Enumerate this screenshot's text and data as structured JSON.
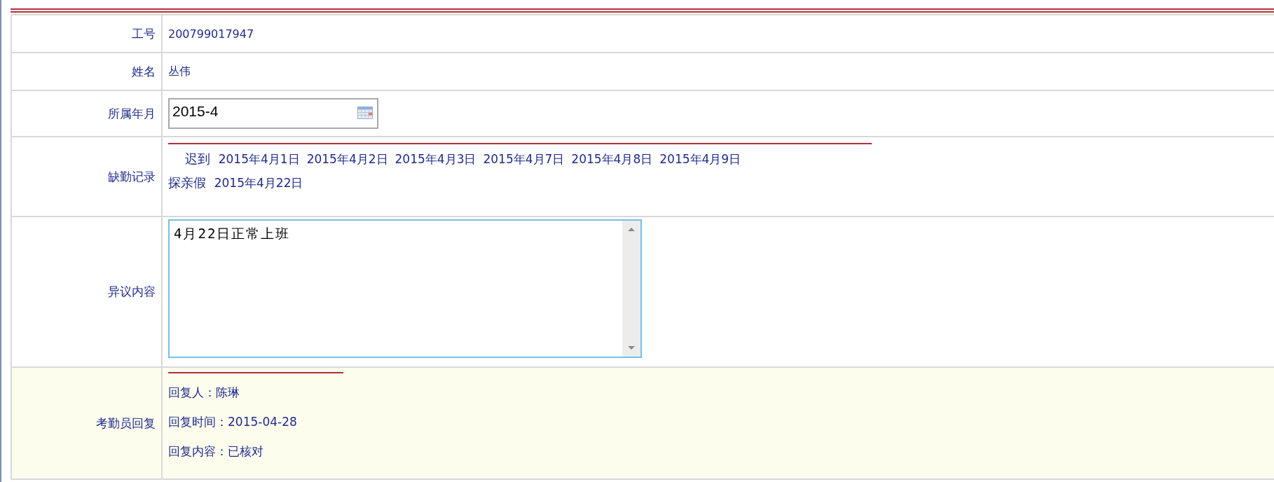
{
  "form": {
    "rows": [
      {
        "kind": "text",
        "label": "工号",
        "value": "200799017947"
      },
      {
        "kind": "text",
        "label": "姓名",
        "value": "丛伟"
      },
      {
        "kind": "date",
        "label": "所属年月",
        "value": "2015-4"
      },
      {
        "kind": "records",
        "label": "缺勤记录",
        "records": [
          {
            "type": "迟到",
            "dates": [
              "2015年4月1日",
              "2015年4月2日",
              "2015年4月3日",
              "2015年4月7日",
              "2015年4月8日",
              "2015年4月9日"
            ]
          },
          {
            "type": "探亲假",
            "dates": [
              "2015年4月22日"
            ]
          }
        ]
      },
      {
        "kind": "textarea",
        "label": "异议内容",
        "value": "4月22日正常上班"
      },
      {
        "kind": "reply",
        "label": "考勤员回复",
        "lines": [
          {
            "label": "回复人：",
            "value": "陈琳"
          },
          {
            "label": "回复时间：",
            "value": "2015-04-28"
          },
          {
            "label": "回复内容：",
            "value": "已核对"
          }
        ]
      }
    ]
  }
}
